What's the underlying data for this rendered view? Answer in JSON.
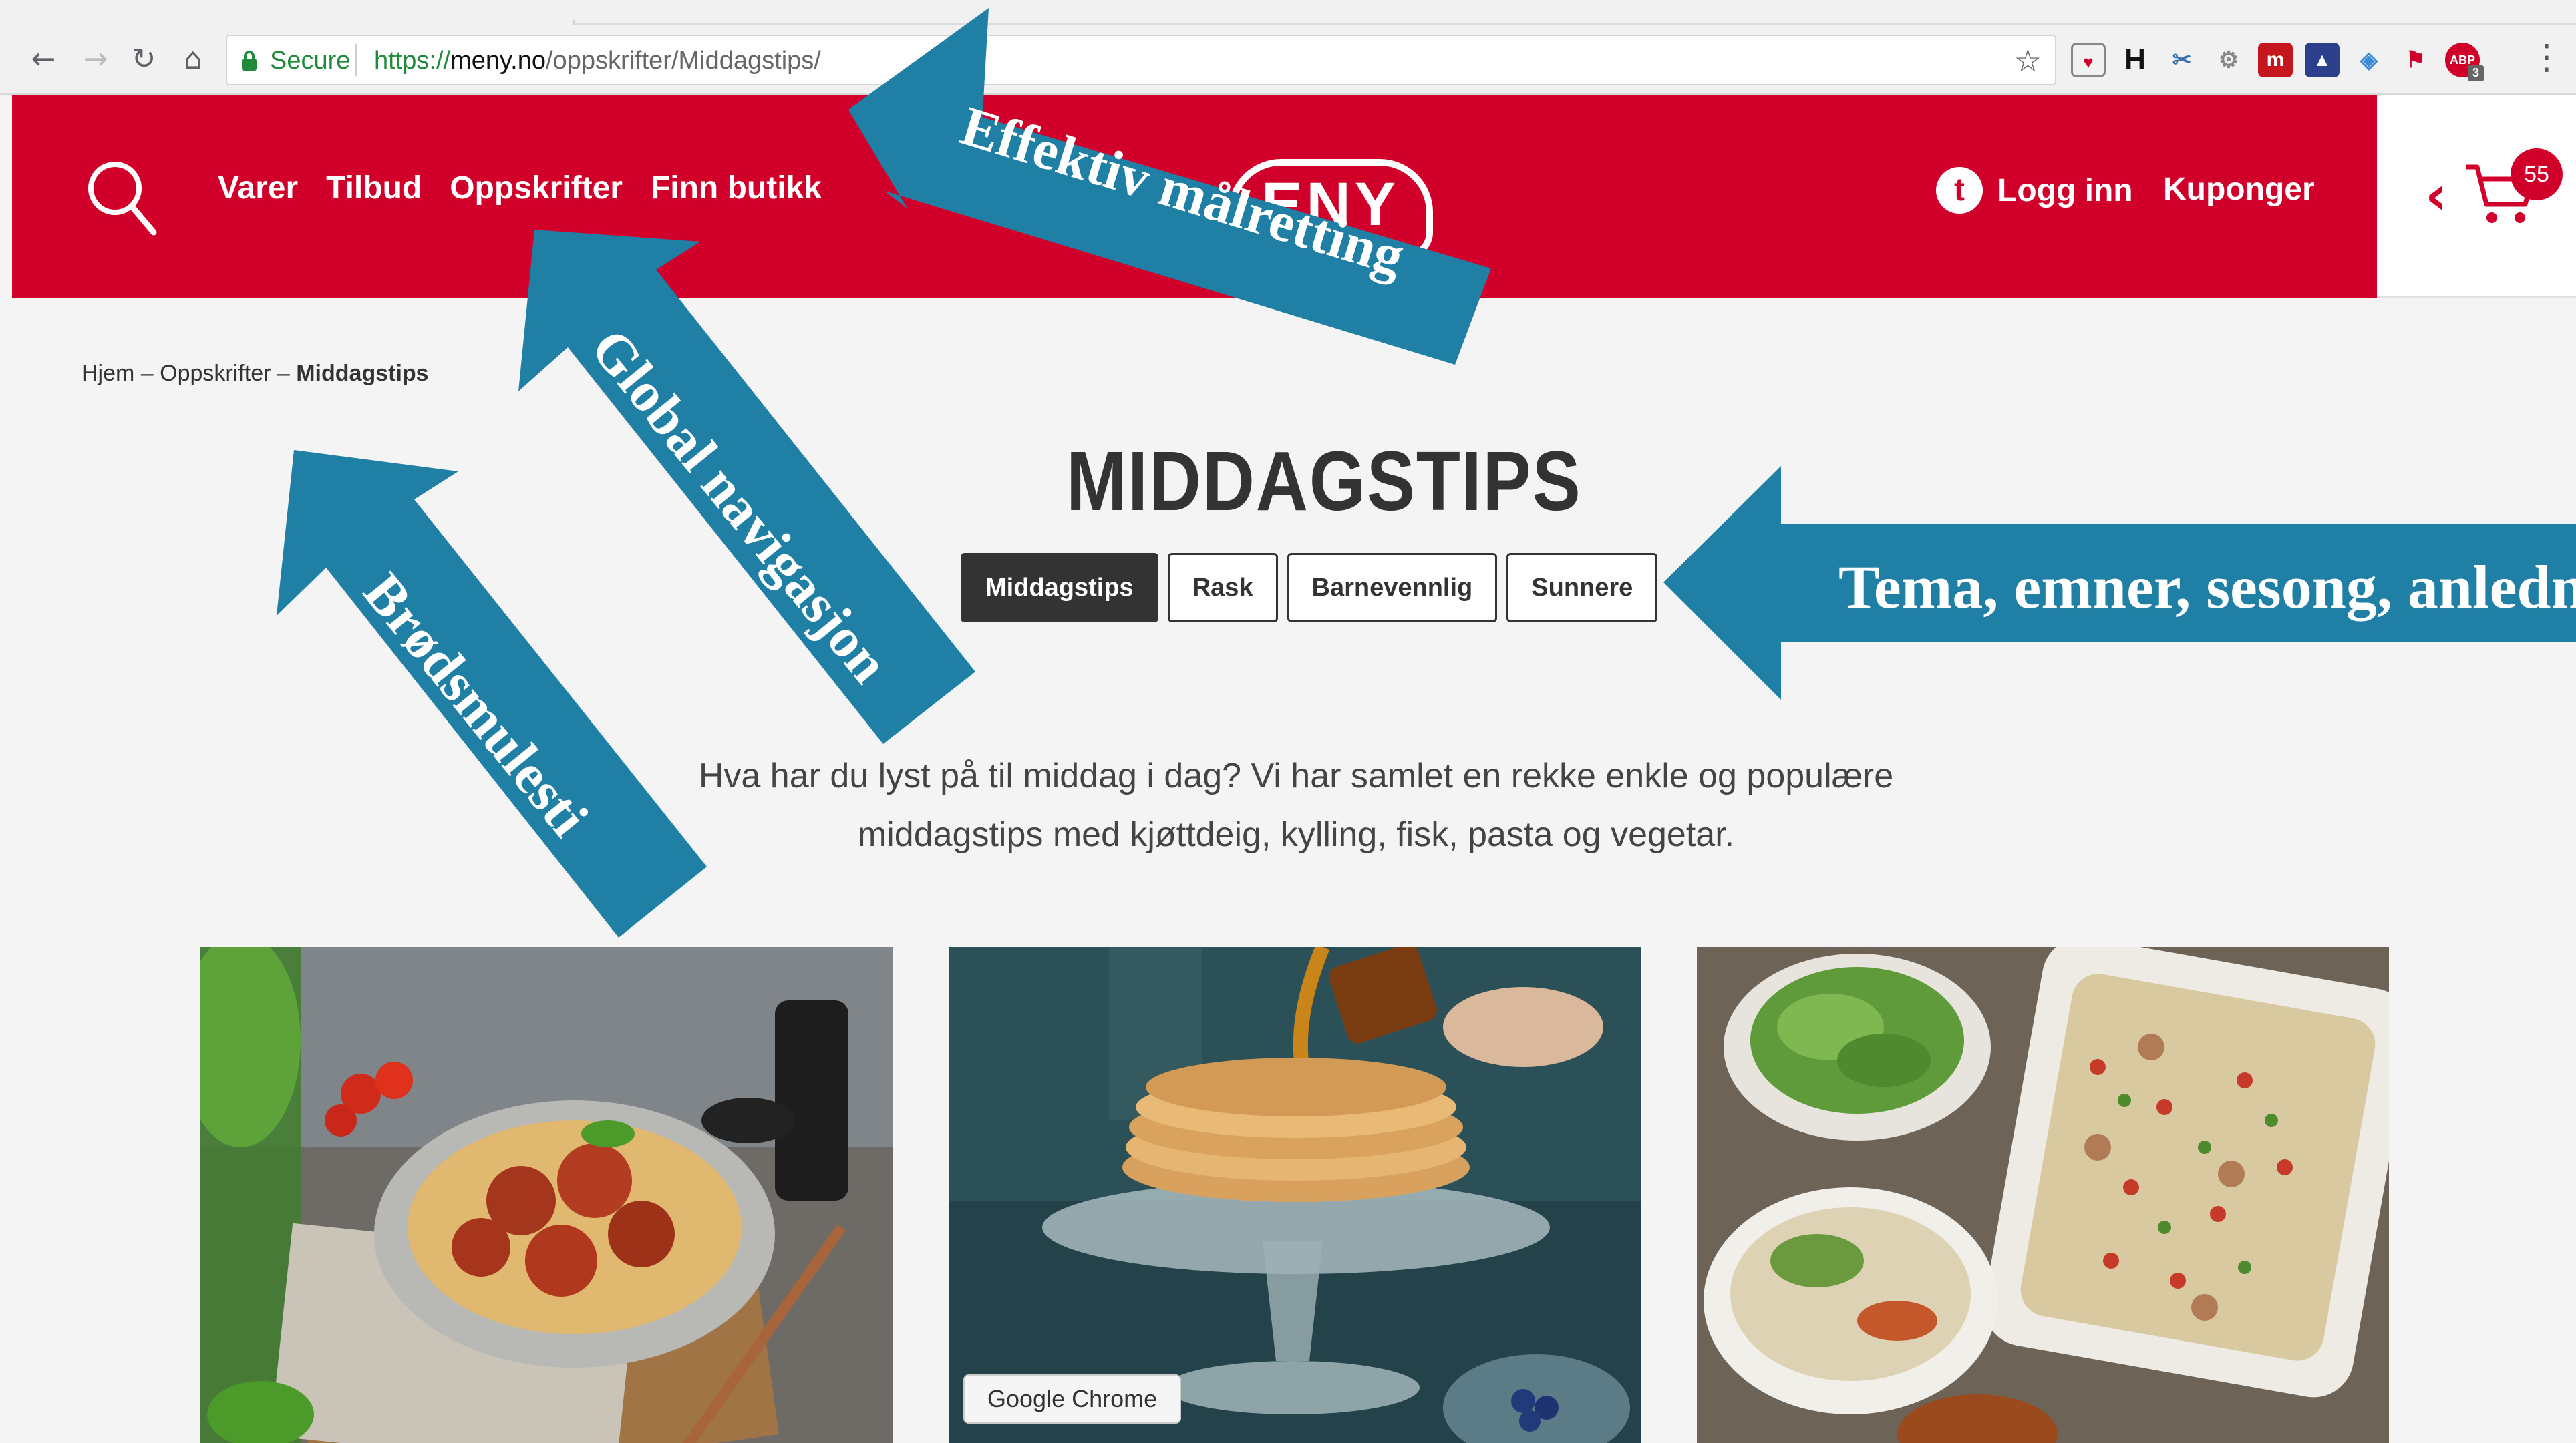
{
  "browser": {
    "secure_label": "Secure",
    "url_scheme": "https://",
    "url_host": "meny.no",
    "url_path": "/oppskrifter/Middagstips/",
    "tooltip": "Google Chrome",
    "extension_badge": "3"
  },
  "header": {
    "nav": [
      "Varer",
      "Tilbud",
      "Oppskrifter",
      "Finn butikk"
    ],
    "logo_text": "ENY",
    "trumf_letter": "t",
    "login_label": "Logg inn",
    "coupons_label": "Kuponger",
    "cart_count": "55",
    "brand_color": "#d1002b"
  },
  "breadcrumb": {
    "home": "Hjem",
    "sep": " – ",
    "parent": "Oppskrifter",
    "current": "Middagstips"
  },
  "page": {
    "title": "MIDDAGSTIPS",
    "tabs": [
      {
        "label": "Middagstips",
        "active": true
      },
      {
        "label": "Rask",
        "active": false
      },
      {
        "label": "Barnevennlig",
        "active": false
      },
      {
        "label": "Sunnere",
        "active": false
      }
    ],
    "intro_line1": "Hva har du lyst på til middag i dag? Vi har samlet en rekke enkle og populære",
    "intro_line2": "middagstips med kjøttdeig, kylling, fisk, pasta og vegetar."
  },
  "annotations": {
    "color": "#1f7fa5",
    "effektiv": "Effektiv målretting",
    "global": "Global navigasjon",
    "brodsmulesti": "Brødsmulesti",
    "tema": "Tema, emner, sesong, anledning"
  }
}
